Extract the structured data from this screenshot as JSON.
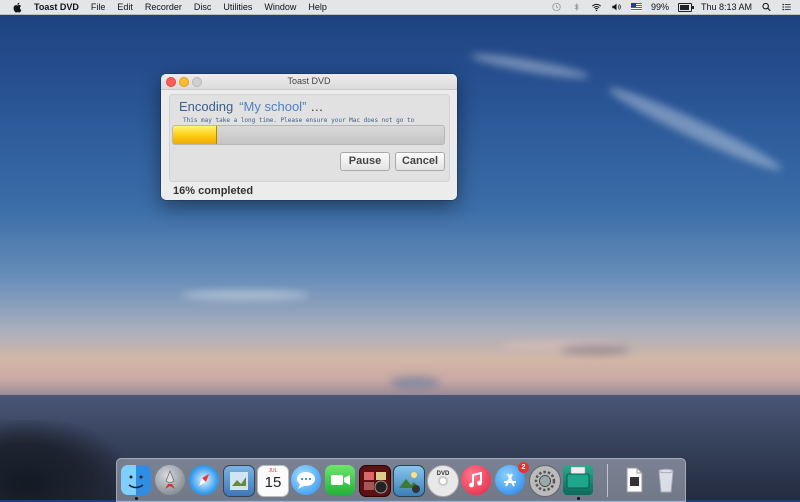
{
  "menubar": {
    "app_name": "Toast DVD",
    "menus": [
      "File",
      "Edit",
      "Recorder",
      "Disc",
      "Utilities",
      "Window",
      "Help"
    ],
    "battery": "99%",
    "clock": "Thu 8:13 AM",
    "status_icons": [
      "time-machine-icon",
      "bluetooth-icon",
      "wifi-icon",
      "volume-icon",
      "us-flag-icon",
      "battery-icon",
      "spotlight-icon",
      "notification-center-icon"
    ]
  },
  "window": {
    "title": "Toast DVD",
    "heading_prefix": "Encoding",
    "project_name": "“My school”",
    "heading_suffix": "…",
    "hint": "This may take a long time. Please ensure your Mac does not go to",
    "progress": 0.16,
    "pause_label": "Pause",
    "cancel_label": "Cancel",
    "status": "16% completed"
  },
  "dock": {
    "calendar_month": "JUL",
    "calendar_day": "15",
    "app_store_badge": "2",
    "icons": [
      "finder-icon",
      "launchpad-icon",
      "safari-icon",
      "preview-icon",
      "calendar-icon",
      "messages-icon",
      "facetime-icon",
      "photo-booth-icon",
      "iphoto-icon",
      "dvd-player-icon",
      "itunes-icon",
      "app-store-icon",
      "system-preferences-icon",
      "toast-icon",
      "documents-icon",
      "trash-icon"
    ]
  },
  "colors": {
    "progress_fill": "#ffd21a",
    "heading": "#3b5f8c",
    "project_name": "#4f80c4"
  }
}
